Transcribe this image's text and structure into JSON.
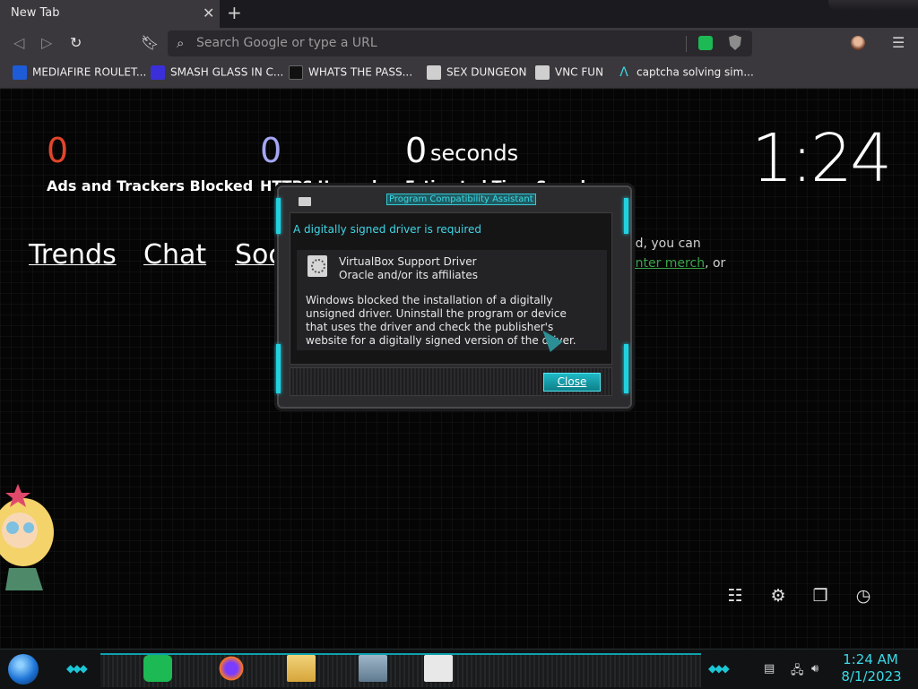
{
  "browser": {
    "tab_title": "New Tab",
    "url_placeholder": "Search Google or type a URL"
  },
  "bookmarks": [
    {
      "label": "MEDIAFIRE ROULET...",
      "icon": "mediafire-icon",
      "color": "#1e5bd7"
    },
    {
      "label": "SMASH GLASS IN C...",
      "icon": "smash-glass-icon",
      "color": "#3b2fd9"
    },
    {
      "label": "WHATS THE PASS...",
      "icon": "lock-icon",
      "color": "#222222"
    },
    {
      "label": "SEX DUNGEON",
      "icon": "cube-icon",
      "color": "#cccccc"
    },
    {
      "label": "VNC FUN",
      "icon": "cube-icon",
      "color": "#cccccc"
    },
    {
      "label": "captcha solving sim...",
      "icon": "lambda-icon",
      "color": "#3ad9e6"
    }
  ],
  "stats": {
    "ads_count": "0",
    "ads_label": "Ads and Trackers Blocked",
    "https_count": "0",
    "https_label": "HTTPS Upgrades",
    "time_count": "0",
    "time_unit": "seconds",
    "time_label": "Estimated Time Saved"
  },
  "clock": "1:24",
  "links": [
    "Trends",
    "Chat",
    "Soc"
  ],
  "side_text": {
    "line1": "ed, you can",
    "merch": "enter merch",
    "line2_suffix": ", or"
  },
  "dialog": {
    "title": "Program Compatibility Assistant",
    "heading": "A digitally signed driver is required",
    "driver_name": "VirtualBox Support Driver",
    "publisher": "Oracle and/or its affiliates",
    "message": "Windows blocked the installation of a digitally unsigned driver.  Uninstall the program or device that uses the driver and check the publisher's website for a digitally signed version of the driver.",
    "close_label": "Close"
  },
  "taskbar": {
    "time": "1:24 AM",
    "date": "8/1/2023"
  },
  "colors": {
    "ads_count": "#e2452c",
    "https_count": "#a4a6f5",
    "accent": "#22d1e0"
  }
}
